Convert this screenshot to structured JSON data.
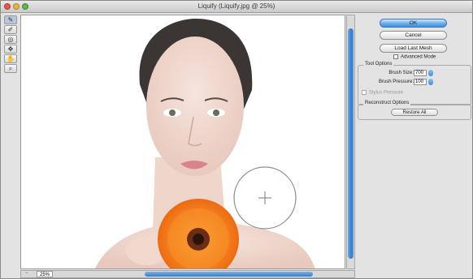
{
  "window": {
    "title": "Liquify (Liquify.jpg @ 25%)"
  },
  "colors": {
    "accent": "#3d90df",
    "traffic_close": "#e9564a",
    "traffic_min": "#e7b53c",
    "traffic_max": "#5fb548"
  },
  "tools": [
    {
      "name": "forward-warp-tool-icon",
      "glyph": "✎"
    },
    {
      "name": "reconstruct-tool-icon",
      "glyph": "✎"
    },
    {
      "name": "pucker-tool-icon",
      "glyph": "◎"
    },
    {
      "name": "push-left-tool-icon",
      "glyph": "✥"
    },
    {
      "name": "hand-tool-icon",
      "glyph": "✋"
    },
    {
      "name": "zoom-tool-icon",
      "glyph": "⌕"
    },
    {
      "name": "eyedropper-tool-icon",
      "glyph": "⌖"
    }
  ],
  "footer": {
    "zoom": "25%"
  },
  "panel": {
    "ok_label": "OK",
    "cancel_label": "Cancel",
    "load_mesh_label": "Load Last Mesh",
    "advanced_mode_label": "Advanced Mode",
    "tool_options_title": "Tool Options",
    "brush_size_label": "Brush Size:",
    "brush_size_value": "700",
    "brush_pressure_label": "Brush Pressure:",
    "brush_pressure_value": "100",
    "stylus_pressure_label": "Stylus Pressure",
    "reconstruct_title": "Reconstruct Options",
    "restore_all_label": "Restore All"
  }
}
